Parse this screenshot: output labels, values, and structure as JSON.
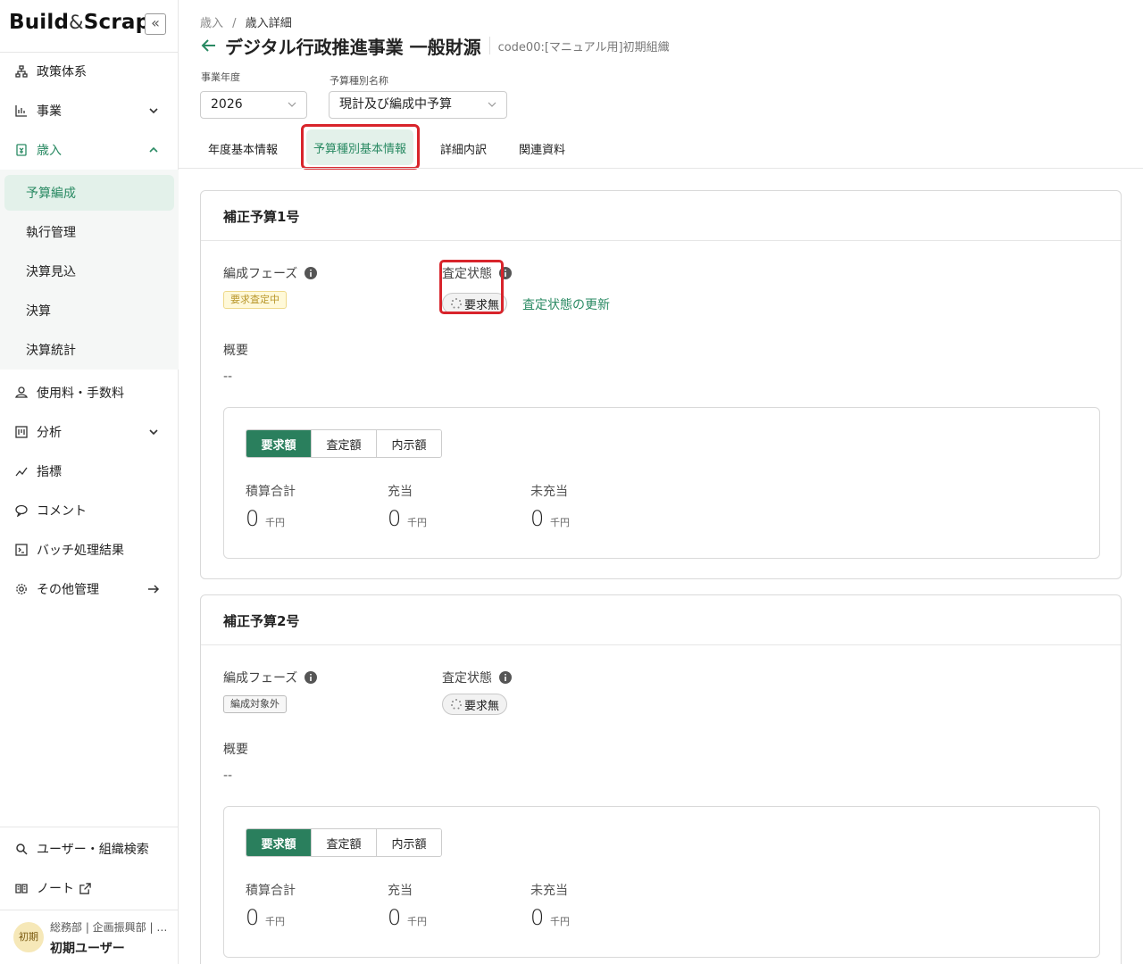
{
  "sidebar": {
    "logo_main": "Build",
    "logo_amp": "&",
    "logo_tail": "Scrap",
    "collapse_glyph": "«",
    "items": [
      {
        "label": "政策体系",
        "icon": "hierarchy-icon"
      },
      {
        "label": "事業",
        "icon": "bar-chart-icon"
      },
      {
        "label": "歳入",
        "icon": "revenue-icon"
      },
      {
        "label": "使用料・手数料",
        "icon": "fee-icon"
      },
      {
        "label": "分析",
        "icon": "analysis-icon"
      },
      {
        "label": "指標",
        "icon": "trend-icon"
      },
      {
        "label": "コメント",
        "icon": "comment-icon"
      },
      {
        "label": "バッチ処理結果",
        "icon": "terminal-icon"
      },
      {
        "label": "その他管理",
        "icon": "gear-icon"
      }
    ],
    "sub_items": [
      "予算編成",
      "執行管理",
      "決算見込",
      "決算",
      "決算統計"
    ],
    "bottom_items": [
      {
        "label": "ユーザー・組織検索",
        "icon": "search-icon"
      },
      {
        "label": "ノート",
        "icon": "book-icon"
      }
    ],
    "user": {
      "avatar": "初期",
      "org": "総務部 | 企画振興部 | …",
      "name": "初期ユーザー"
    },
    "accent": "#2a8a63"
  },
  "header": {
    "breadcrumb": [
      "歳入",
      "/",
      "歳入詳細"
    ],
    "title": "デジタル行政推進事業 一般財源",
    "org": "code00:[マニュアル用]初期組織",
    "fiscal_year_label": "事業年度",
    "fiscal_year": "2026",
    "budget_type_label": "予算種別名称",
    "budget_type": "現計及び編成中予算",
    "tabs": [
      "年度基本情報",
      "予算種別基本情報",
      "詳細内訳",
      "関連資料"
    ],
    "active_tab": "予算種別基本情報"
  },
  "cards": [
    {
      "title": "補正予算1号",
      "phase_label": "編成フェーズ",
      "phase": "要求査定中",
      "status_label": "査定状態",
      "status": "要求無",
      "update_link": "査定状態の更新",
      "summary_label": "概要",
      "summary": "--",
      "segments": [
        "要求額",
        "査定額",
        "内示額"
      ],
      "metrics": [
        {
          "label": "積算合計",
          "value": "0",
          "unit": "千円"
        },
        {
          "label": "充当",
          "value": "0",
          "unit": "千円"
        },
        {
          "label": "未充当",
          "value": "0",
          "unit": "千円"
        }
      ]
    },
    {
      "title": "補正予算2号",
      "phase_label": "編成フェーズ",
      "phase": "編成対象外",
      "status_label": "査定状態",
      "status": "要求無",
      "summary_label": "概要",
      "summary": "--",
      "segments": [
        "要求額",
        "査定額",
        "内示額"
      ],
      "metrics": [
        {
          "label": "積算合計",
          "value": "0",
          "unit": "千円"
        },
        {
          "label": "充当",
          "value": "0",
          "unit": "千円"
        },
        {
          "label": "未充当",
          "value": "0",
          "unit": "千円"
        }
      ]
    }
  ]
}
